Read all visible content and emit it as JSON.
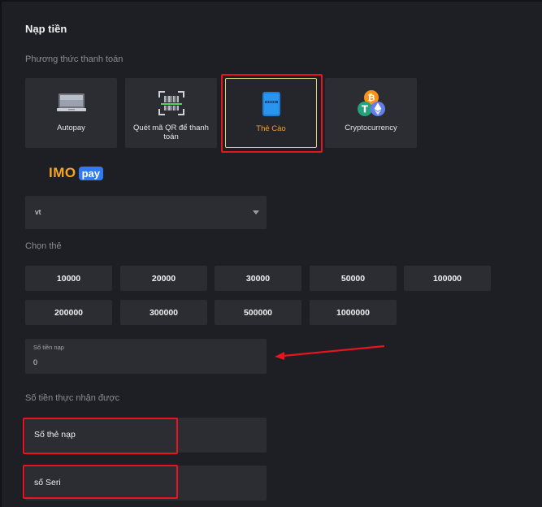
{
  "page": {
    "title": "Nạp tiền",
    "payment_method_label": "Phương thức thanh toán",
    "choose_card_label": "Chọn thẻ",
    "received_label": "Số tiền thực nhận được"
  },
  "methods": [
    {
      "label": "Autopay",
      "icon": "monitor-icon",
      "selected": false
    },
    {
      "label": "Quét mã QR để thanh toán",
      "icon": "qr-scan-icon",
      "selected": false
    },
    {
      "label": "Thẻ Cào",
      "icon": "scratch-card-icon",
      "selected": true
    },
    {
      "label": "Cryptocurrency",
      "icon": "crypto-coins-icon",
      "selected": false
    }
  ],
  "brand": {
    "imo": "IMO",
    "pay": "pay"
  },
  "provider_select": {
    "value": "vt"
  },
  "amounts": [
    "10000",
    "20000",
    "30000",
    "50000",
    "100000",
    "200000",
    "300000",
    "500000",
    "1000000"
  ],
  "deposit_input": {
    "label": "Số tiền nạp",
    "value": "0"
  },
  "card_number": {
    "label": "Số thẻ nạp"
  },
  "serial_number": {
    "label": "số Seri"
  },
  "colors": {
    "background": "#1e1f24",
    "card": "#2b2d33",
    "selected_text": "#f0a23c",
    "highlight_red": "#e8141f",
    "brand_orange": "#f5a623",
    "brand_blue": "#2f7bf0"
  }
}
